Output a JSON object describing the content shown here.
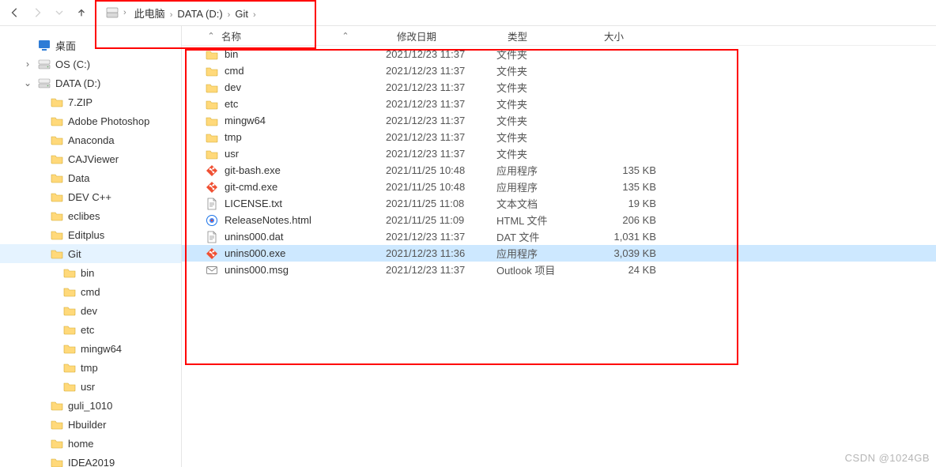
{
  "breadcrumb": {
    "items": [
      "此电脑",
      "DATA (D:)",
      "Git"
    ]
  },
  "columns": {
    "name": "名称",
    "date": "修改日期",
    "type": "类型",
    "size": "大小"
  },
  "sidebar": {
    "items": [
      {
        "label": "桌面",
        "icon": "desktop",
        "depth": 1,
        "chev": ""
      },
      {
        "label": "OS (C:)",
        "icon": "drive",
        "depth": 1,
        "chev": "›"
      },
      {
        "label": "DATA (D:)",
        "icon": "drive",
        "depth": 1,
        "chev": "⌄"
      },
      {
        "label": "7.ZIP",
        "icon": "folder",
        "depth": 2,
        "chev": ""
      },
      {
        "label": "Adobe Photoshop",
        "icon": "folder",
        "depth": 2,
        "chev": ""
      },
      {
        "label": "Anaconda",
        "icon": "folder",
        "depth": 2,
        "chev": ""
      },
      {
        "label": "CAJViewer",
        "icon": "folder",
        "depth": 2,
        "chev": ""
      },
      {
        "label": "Data",
        "icon": "folder",
        "depth": 2,
        "chev": ""
      },
      {
        "label": "DEV C++",
        "icon": "folder",
        "depth": 2,
        "chev": ""
      },
      {
        "label": "eclibes",
        "icon": "folder",
        "depth": 2,
        "chev": ""
      },
      {
        "label": "Editplus",
        "icon": "folder",
        "depth": 2,
        "chev": ""
      },
      {
        "label": "Git",
        "icon": "folder",
        "depth": 2,
        "chev": "",
        "selected": true,
        "expanded": true
      },
      {
        "label": "bin",
        "icon": "folder",
        "depth": 3,
        "chev": ""
      },
      {
        "label": "cmd",
        "icon": "folder",
        "depth": 3,
        "chev": ""
      },
      {
        "label": "dev",
        "icon": "folder",
        "depth": 3,
        "chev": ""
      },
      {
        "label": "etc",
        "icon": "folder",
        "depth": 3,
        "chev": ""
      },
      {
        "label": "mingw64",
        "icon": "folder",
        "depth": 3,
        "chev": ""
      },
      {
        "label": "tmp",
        "icon": "folder",
        "depth": 3,
        "chev": ""
      },
      {
        "label": "usr",
        "icon": "folder",
        "depth": 3,
        "chev": ""
      },
      {
        "label": "guli_1010",
        "icon": "folder",
        "depth": 2,
        "chev": ""
      },
      {
        "label": "Hbuilder",
        "icon": "folder",
        "depth": 2,
        "chev": ""
      },
      {
        "label": "home",
        "icon": "folder",
        "depth": 2,
        "chev": ""
      },
      {
        "label": "IDEA2019",
        "icon": "folder",
        "depth": 2,
        "chev": ""
      }
    ]
  },
  "files": [
    {
      "name": "bin",
      "date": "2021/12/23 11:37",
      "type": "文件夹",
      "size": "",
      "icon": "folder"
    },
    {
      "name": "cmd",
      "date": "2021/12/23 11:37",
      "type": "文件夹",
      "size": "",
      "icon": "folder"
    },
    {
      "name": "dev",
      "date": "2021/12/23 11:37",
      "type": "文件夹",
      "size": "",
      "icon": "folder"
    },
    {
      "name": "etc",
      "date": "2021/12/23 11:37",
      "type": "文件夹",
      "size": "",
      "icon": "folder"
    },
    {
      "name": "mingw64",
      "date": "2021/12/23 11:37",
      "type": "文件夹",
      "size": "",
      "icon": "folder"
    },
    {
      "name": "tmp",
      "date": "2021/12/23 11:37",
      "type": "文件夹",
      "size": "",
      "icon": "folder"
    },
    {
      "name": "usr",
      "date": "2021/12/23 11:37",
      "type": "文件夹",
      "size": "",
      "icon": "folder"
    },
    {
      "name": "git-bash.exe",
      "date": "2021/11/25 10:48",
      "type": "应用程序",
      "size": "135 KB",
      "icon": "git"
    },
    {
      "name": "git-cmd.exe",
      "date": "2021/11/25 10:48",
      "type": "应用程序",
      "size": "135 KB",
      "icon": "git"
    },
    {
      "name": "LICENSE.txt",
      "date": "2021/11/25 11:08",
      "type": "文本文档",
      "size": "19 KB",
      "icon": "txt"
    },
    {
      "name": "ReleaseNotes.html",
      "date": "2021/11/25 11:09",
      "type": "HTML 文件",
      "size": "206 KB",
      "icon": "html"
    },
    {
      "name": "unins000.dat",
      "date": "2021/12/23 11:37",
      "type": "DAT 文件",
      "size": "1,031 KB",
      "icon": "dat"
    },
    {
      "name": "unins000.exe",
      "date": "2021/12/23 11:36",
      "type": "应用程序",
      "size": "3,039 KB",
      "icon": "git",
      "selected": true
    },
    {
      "name": "unins000.msg",
      "date": "2021/12/23 11:37",
      "type": "Outlook 项目",
      "size": "24 KB",
      "icon": "msg"
    }
  ],
  "watermark": "CSDN @1024GB"
}
